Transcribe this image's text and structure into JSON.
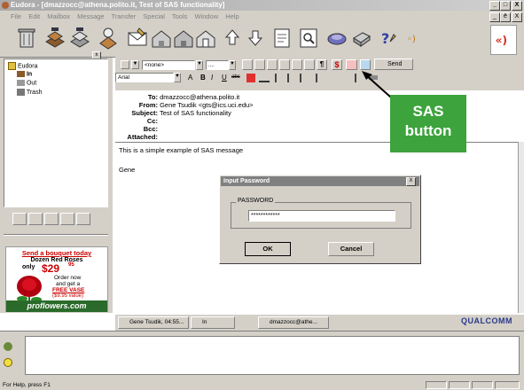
{
  "window": {
    "title": "Eudora - [dmazzocc@athena.polito.it, Test of SAS functionality]",
    "min": "_",
    "max": "□",
    "close": "X",
    "doc_min": "_",
    "doc_max": "ē",
    "doc_close": "X"
  },
  "menu": [
    "File",
    "Edit",
    "Mailbox",
    "Message",
    "Transfer",
    "Special",
    "Tools",
    "Window",
    "Help"
  ],
  "format_bar": {
    "priority": "<none>",
    "font": "Arial",
    "signature": "....",
    "send_label": "Send",
    "bold": "B",
    "italic": "I",
    "underline": "U",
    "strike": "abc",
    "size": "A",
    "sas_symbol": "$"
  },
  "tree": {
    "root": "Eudora",
    "items": [
      "In",
      "Out",
      "Trash"
    ]
  },
  "ad": {
    "headline": "Send a bouquet today",
    "line1": "Dozen Red Roses",
    "only": "only",
    "price": "$29",
    "price_sup": "95",
    "order1": "Order now",
    "order2": "and get a",
    "free": "FREE VASE",
    "value": "($9.95 value)",
    "brand": "proflowers.com"
  },
  "header_fields": [
    {
      "label": "To:",
      "value": "dmazzocc@athena.polito.it"
    },
    {
      "label": "From:",
      "value": "Gene Tsudik <gts@ics.uci.edu>"
    },
    {
      "label": "Subject:",
      "value": "Test of SAS functionality"
    },
    {
      "label": "Cc:",
      "value": ""
    },
    {
      "label": "Bcc:",
      "value": ""
    },
    {
      "label": "Attached:",
      "value": ""
    }
  ],
  "body": {
    "line1": "This is a simple example of SAS message",
    "signoff": "Gene"
  },
  "dialog": {
    "title": "Input Password",
    "close": "X",
    "group": "PASSWORD",
    "value": "************",
    "ok": "OK",
    "cancel": "Cancel"
  },
  "callout": {
    "line1": "SAS",
    "line2": "button"
  },
  "taskbar": {
    "items": [
      "Gene Tsudik, 04:55...",
      "In",
      "dmazzocc@athe..."
    ],
    "brand": "QUALCOMM"
  },
  "status": {
    "text": "For Help, press F1"
  },
  "colors": {
    "callout_bg": "#3da33d",
    "ad_red": "#cc0000",
    "brand_blue": "#2a3a8a"
  }
}
